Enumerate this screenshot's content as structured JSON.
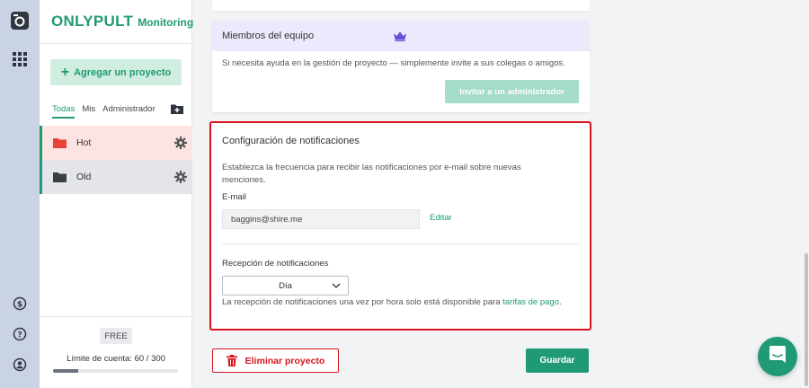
{
  "brand": {
    "name": "ONLYPULT",
    "product": "Monitoring"
  },
  "sidebar": {
    "add_project": "Agregar un proyecto",
    "filters": [
      "Todas",
      "Mis",
      "Administrador"
    ],
    "active_filter": "Todas",
    "projects": [
      {
        "name": "Hot",
        "folder_color": "#e8433a"
      },
      {
        "name": "Old",
        "folder_color": "#3a3f46"
      }
    ],
    "plan": "FREE",
    "account_limit": "Límite de cuenta: 60 / 300",
    "account_usage_fraction": 0.2
  },
  "team": {
    "title": "Miembros del equipo",
    "text": "Si necesita ayuda en la gestión de proyecto — simplemente invite a sus colegas o amigos.",
    "invite_button": "Invitar a un administrador"
  },
  "notifications": {
    "title": "Configuración de notificaciones",
    "description": "Establezca la frecuencia para recibir las notificaciones por e-mail sobre nuevas menciones.",
    "email_label": "E-mail",
    "email_value": "baggins@shire.me",
    "edit_link": "Editar",
    "reception_label": "Recepción de notificaciones",
    "frequency_selected": "Día",
    "note_text": "La recepción de notificaciones una vez por hora solo está disponible para ",
    "note_link": "tarifas de pago",
    "note_end": "."
  },
  "actions": {
    "delete": "Eliminar proyecto",
    "save": "Guardar"
  },
  "colors": {
    "accent": "#1f9a74",
    "danger": "#d9141c",
    "team_header": "#ece9fc",
    "crown": "#6c4fd8"
  }
}
